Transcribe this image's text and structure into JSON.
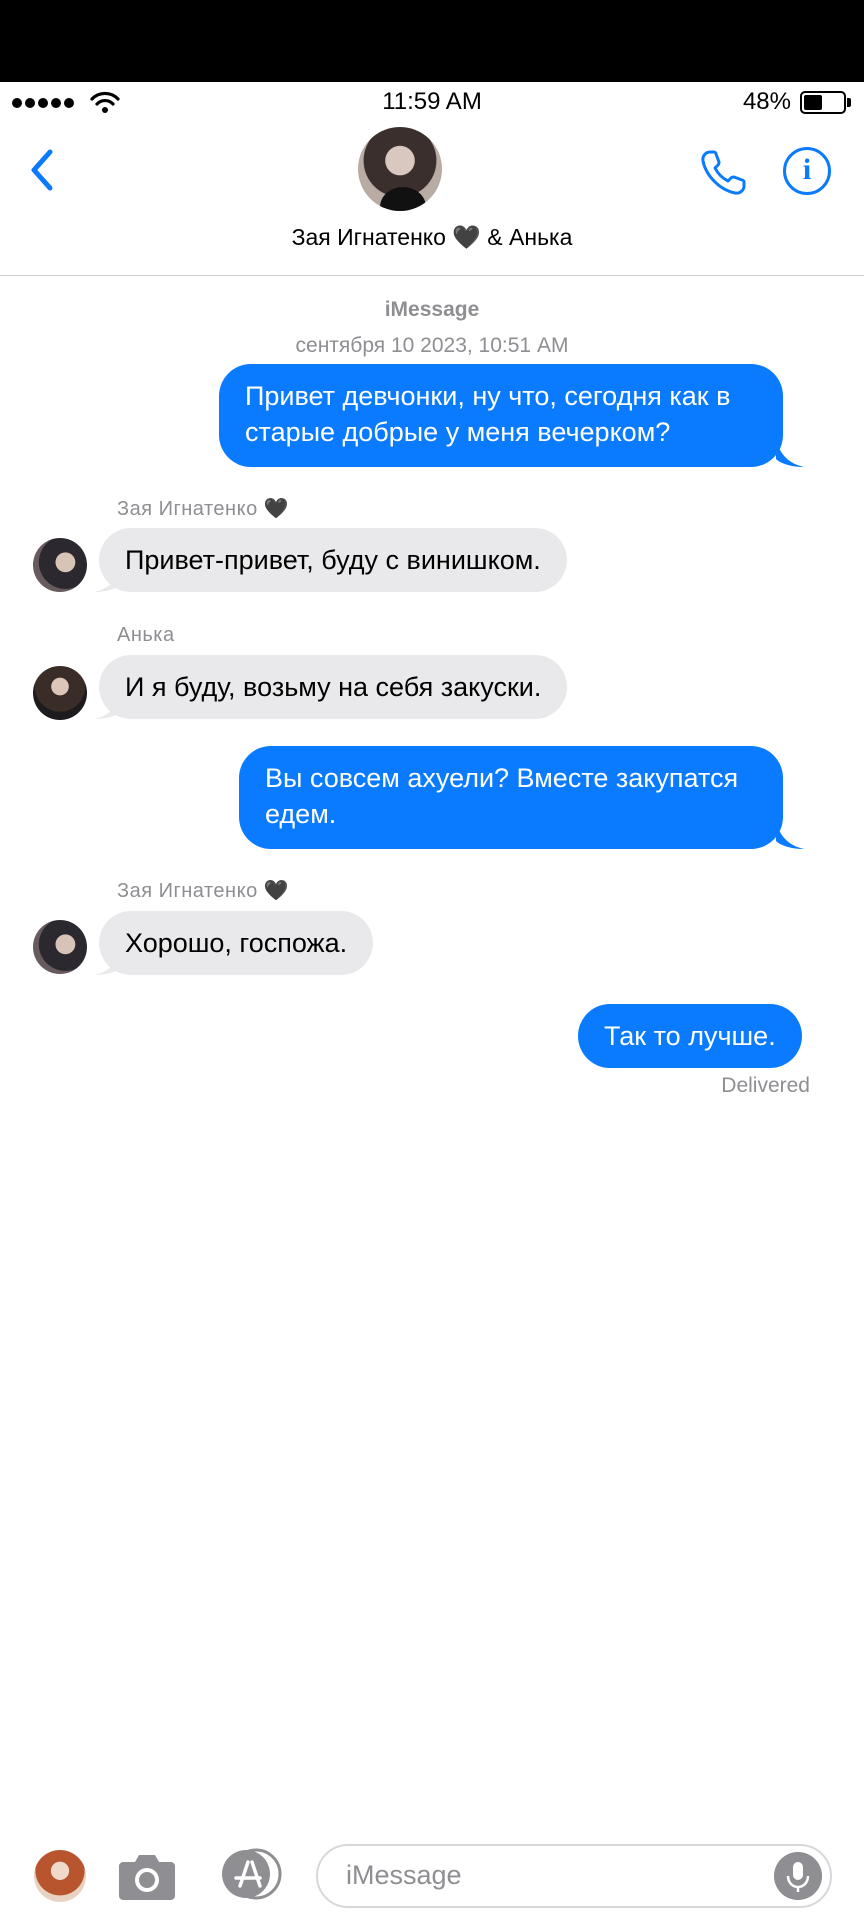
{
  "status_bar": {
    "time": "11:59 AM",
    "battery_percent_label": "48%",
    "battery_level": 0.48,
    "signal_icon": "cellular-signal-icon",
    "wifi_icon": "wifi-icon"
  },
  "nav": {
    "title": "Зая Игнатенко 🖤 & Анька",
    "back_icon": "chevron-left-icon",
    "call_icon": "phone-icon",
    "info_icon": "info-icon",
    "info_glyph": "i",
    "accent_color": "#0a7bff"
  },
  "conversation": {
    "service_label": "iMessage",
    "timestamp": "сентября 10 2023, 10:51 AM",
    "messages": [
      {
        "direction": "outgoing",
        "text": "Привет девчонки, ну что, сегодня как в старые добрые у меня вечерком?"
      },
      {
        "direction": "incoming",
        "sender": "Зая Игнатенко 🖤",
        "text": "Привет-привет, буду с винишком."
      },
      {
        "direction": "incoming",
        "sender": "Анька",
        "text": "И я буду, возьму на себя закуски."
      },
      {
        "direction": "outgoing",
        "text": "Вы совсем ахуели? Вместе закупатся едем."
      },
      {
        "direction": "incoming",
        "sender": "Зая Игнатенко 🖤",
        "text": "Хорошо, госпожа."
      },
      {
        "direction": "outgoing",
        "text": "Так то лучше."
      }
    ],
    "delivery_status": "Delivered",
    "outgoing_color": "#0a7bff",
    "incoming_color": "#e9e9eb"
  },
  "composer": {
    "placeholder": "iMessage",
    "camera_icon": "camera-icon",
    "apps_icon": "app-store-icon",
    "mic_icon": "microphone-icon"
  }
}
